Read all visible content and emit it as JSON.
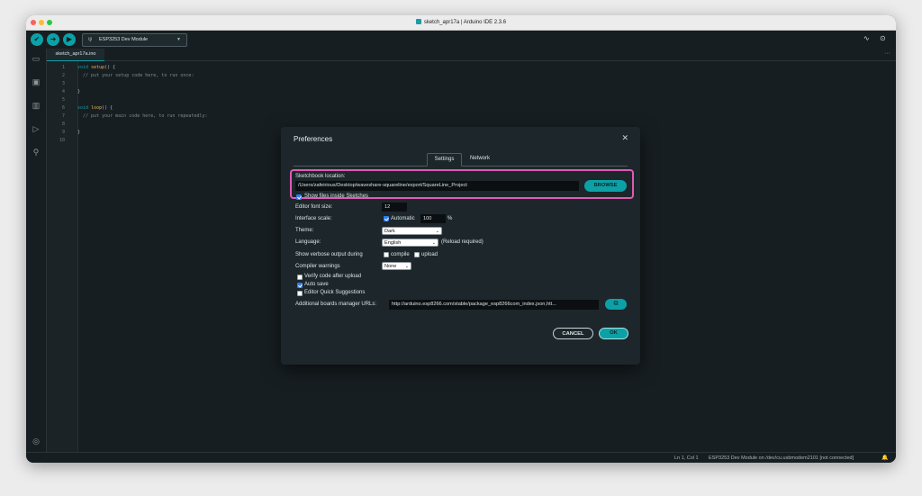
{
  "window": {
    "title": "sketch_apr17a | Arduino IDE 2.3.6"
  },
  "toolbar": {
    "verify_icon": "check-icon",
    "upload_icon": "arrow-right-icon",
    "debug_icon": "debug-icon",
    "board_name": "ESP3253 Dev Module",
    "serial_plotter_icon": "pulse-icon",
    "serial_monitor_icon": "magnifier-dots-icon"
  },
  "sidebar": {
    "items": [
      {
        "icon": "folder-icon"
      },
      {
        "icon": "board-icon"
      },
      {
        "icon": "library-icon"
      },
      {
        "icon": "debug-play-icon"
      },
      {
        "icon": "search-icon"
      }
    ],
    "profile_icon": "account-icon"
  },
  "tabs": {
    "file_tab": "sketch_apr17a.ino",
    "more": "···"
  },
  "editor": {
    "lines": [
      {
        "num": "1",
        "kw": "void ",
        "fn": "setup",
        "rest": "() {",
        "cm": ""
      },
      {
        "num": "2",
        "kw": "",
        "fn": "",
        "rest": "  ",
        "cm": "// put your setup code here, to run once:"
      },
      {
        "num": "3",
        "kw": "",
        "fn": "",
        "rest": "",
        "cm": ""
      },
      {
        "num": "4",
        "kw": "",
        "fn": "",
        "rest": "}",
        "cm": ""
      },
      {
        "num": "5",
        "kw": "",
        "fn": "",
        "rest": "",
        "cm": ""
      },
      {
        "num": "6",
        "kw": "void ",
        "fn": "loop",
        "rest": "() {",
        "cm": ""
      },
      {
        "num": "7",
        "kw": "",
        "fn": "",
        "rest": "  ",
        "cm": "// put your main code here, to run repeatedly:"
      },
      {
        "num": "8",
        "kw": "",
        "fn": "",
        "rest": "",
        "cm": ""
      },
      {
        "num": "9",
        "kw": "",
        "fn": "",
        "rest": "}",
        "cm": ""
      },
      {
        "num": "10",
        "kw": "",
        "fn": "",
        "rest": "",
        "cm": ""
      }
    ]
  },
  "dialog": {
    "title": "Preferences",
    "tabs": [
      "Settings",
      "Network"
    ],
    "sketchbook_label": "Sketchbook location:",
    "sketchbook_path": "/Users/zafeirious/Desktop/waveshare-squareline/export/SquareLine_Project",
    "browse_label": "BROWSE",
    "show_files_label": "Show files inside Sketches",
    "font_size_label": "Editor font size:",
    "font_size_value": "12",
    "scale_label": "Interface scale:",
    "scale_auto_label": "Automatic",
    "scale_value": "100",
    "scale_unit": "%",
    "theme_label": "Theme:",
    "theme_value": "Dark",
    "language_label": "Language:",
    "language_value": "English",
    "language_note": "(Reload required)",
    "verbose_label": "Show verbose output during",
    "verbose_compile": "compile",
    "verbose_upload": "upload",
    "warnings_label": "Compiler warnings",
    "warnings_value": "None",
    "verify_label": "Verify code after upload",
    "autosave_label": "Auto save",
    "quick_suggestions_label": "Editor Quick Suggestions",
    "urls_label": "Additional boards manager URLs:",
    "urls_value": "http://arduino.esp8266.com/stable/package_esp8266com_index.json,htt...",
    "urls_button_icon": "open-window-icon",
    "cancel_label": "CANCEL",
    "ok_label": "OK",
    "close_icon": "close-icon"
  },
  "status": {
    "position": "Ln 1, Col 1",
    "board": "ESP3253 Dev Module on /dev/cu.usbmodem2101 [not connected]",
    "bell_icon": "bell-icon"
  },
  "colors": {
    "accent": "#0ca1a6",
    "background": "#171e21",
    "highlight": "#e05bb5"
  }
}
